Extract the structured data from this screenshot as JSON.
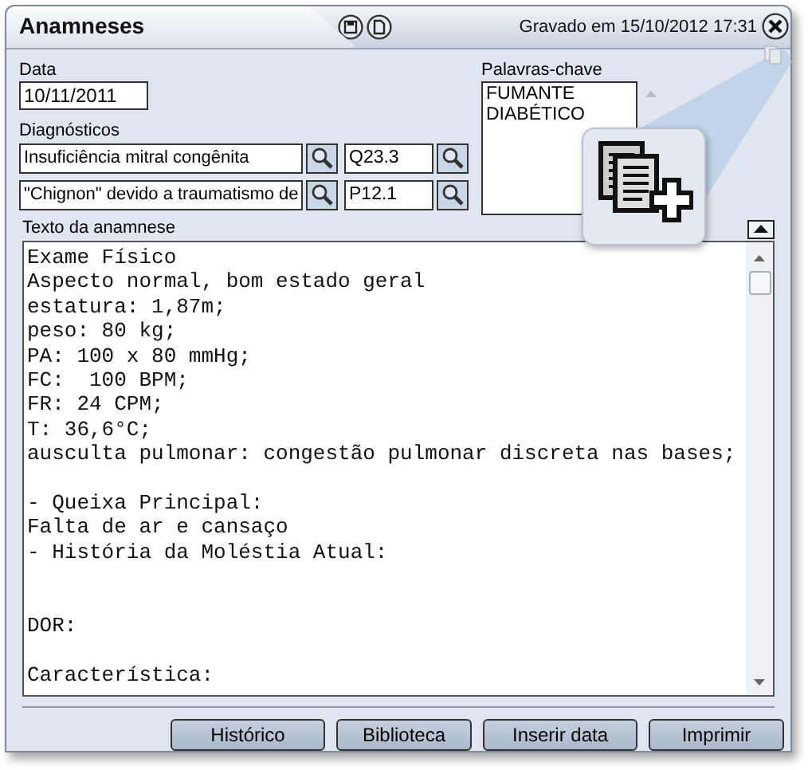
{
  "window": {
    "title": "Anamneses",
    "saved": "Gravado em 15/10/2012 17:31"
  },
  "date": {
    "label": "Data",
    "value": "10/11/2011"
  },
  "diagnoses": {
    "label": "Diagnósticos",
    "rows": [
      {
        "description": "Insuficiência mitral congênita",
        "code": "Q23.3"
      },
      {
        "description": "\"Chignon\" devido a traumatismo de",
        "code": "P12.1"
      }
    ]
  },
  "keywords": {
    "label": "Palavras-chave",
    "items": [
      "FUMANTE",
      "DIABÉTICO"
    ]
  },
  "anamnesis": {
    "label": "Texto da anamnese",
    "text": "Exame Físico\nAspecto normal, bom estado geral\nestatura: 1,87m;\npeso: 80 kg;\nPA: 100 x 80 mmHg;\nFC:  100 BPM;\nFR: 24 CPM;\nT: 36,6°C;\nausculta pulmonar: congestão pulmonar discreta nas bases;\n\n- Queixa Principal:\nFalta de ar e cansaço\n- História da Moléstia Atual:\n\n\nDOR:\n\nCaracterística:"
  },
  "buttons": [
    "Histórico",
    "Biblioteca",
    "Inserir data",
    "Imprimir"
  ]
}
